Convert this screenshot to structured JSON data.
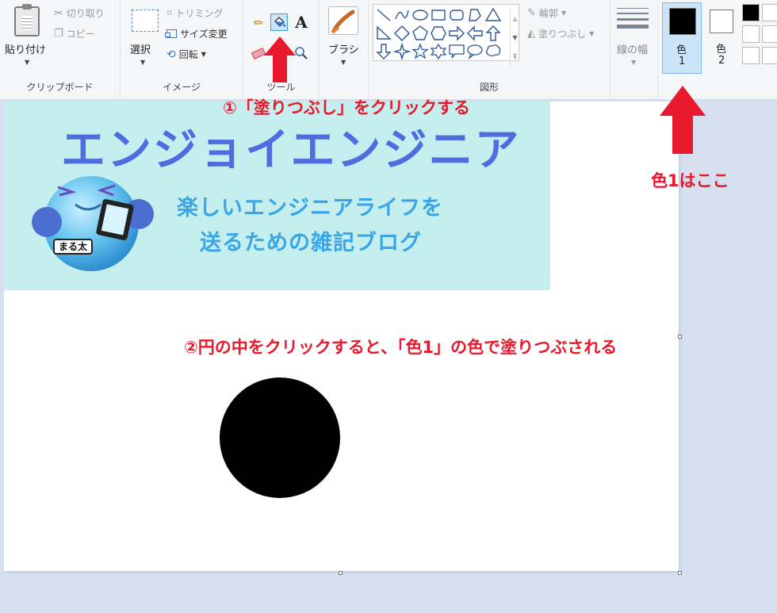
{
  "ribbon": {
    "clipboard": {
      "paste_label": "貼り付け",
      "cut_label": "切り取り",
      "copy_label": "コピー",
      "group_label": "クリップボード"
    },
    "image": {
      "select_label": "選択",
      "crop_label": "トリミング",
      "resize_label": "サイズ変更",
      "rotate_label": "回転",
      "group_label": "イメージ"
    },
    "tools": {
      "text_tool_glyph": "A",
      "group_label": "ツール"
    },
    "brushes": {
      "label": "ブラシ"
    },
    "shapes": {
      "outline_label": "輪郭",
      "fill_label": "塗りつぶし",
      "group_label": "図形"
    },
    "size": {
      "label": "線の幅"
    },
    "colors": {
      "color1_label_top": "色",
      "color1_label_bottom": "1",
      "color2_label_top": "色",
      "color2_label_bottom": "2",
      "color1_value": "#000000",
      "color2_value": "#ffffff",
      "palette": [
        "#000000",
        "#ffffff",
        "#ffffff",
        "#ffffff",
        "#ffffff",
        "#ffffff"
      ]
    }
  },
  "canvas": {
    "banner": {
      "title": "エンジョイエンジニア",
      "subtitle_line1": "楽しいエンジニアライフを",
      "subtitle_line2": "送るための雑記ブログ",
      "mascot_tag": "まる太",
      "background": "#c5efee",
      "title_color": "#4e6ee0",
      "subtitle_color": "#3aa6e8"
    },
    "circle_fill": "#000000"
  },
  "annotations": {
    "step1": "①「塗りつぶし」をクリックする",
    "color1_note": "色1はここ",
    "step2": "②円の中をクリックすると、「色1」の色で塗りつぶされる",
    "accent": "#e8192c"
  }
}
